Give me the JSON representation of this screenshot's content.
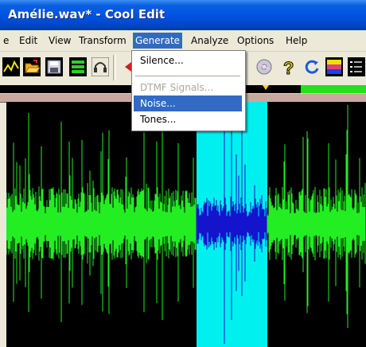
{
  "window": {
    "title": "Amélie.wav* - Cool Edit"
  },
  "menubar": {
    "items": [
      {
        "label": "e"
      },
      {
        "label": "Edit"
      },
      {
        "label": "View"
      },
      {
        "label": "Transform"
      },
      {
        "label": "Generate"
      },
      {
        "label": "Analyze"
      },
      {
        "label": "Options"
      },
      {
        "label": "Help"
      }
    ]
  },
  "generate_menu": {
    "items": [
      {
        "label": "Silence...",
        "enabled": true
      },
      {
        "label": "DTMF Signals...",
        "enabled": false
      },
      {
        "label": "Noise...",
        "enabled": true,
        "highlighted": true
      },
      {
        "label": "Tones...",
        "enabled": true
      }
    ]
  },
  "toolbar": {
    "icons": [
      "waveform-tool-icon",
      "open-folder-icon",
      "save-icon",
      "multitrack-icon",
      "headphones-icon",
      "rewind-icon",
      "cd-icon",
      "help-icon",
      "loop-icon",
      "spectral-icon",
      "display-options-icon"
    ]
  },
  "colors": {
    "waveform": "#22ee22",
    "waveform_selected": "#1414cc",
    "selection": "#00f0f0",
    "background": "#000000",
    "title_bar": "#0054e3",
    "menu_highlight": "#316ac5"
  }
}
